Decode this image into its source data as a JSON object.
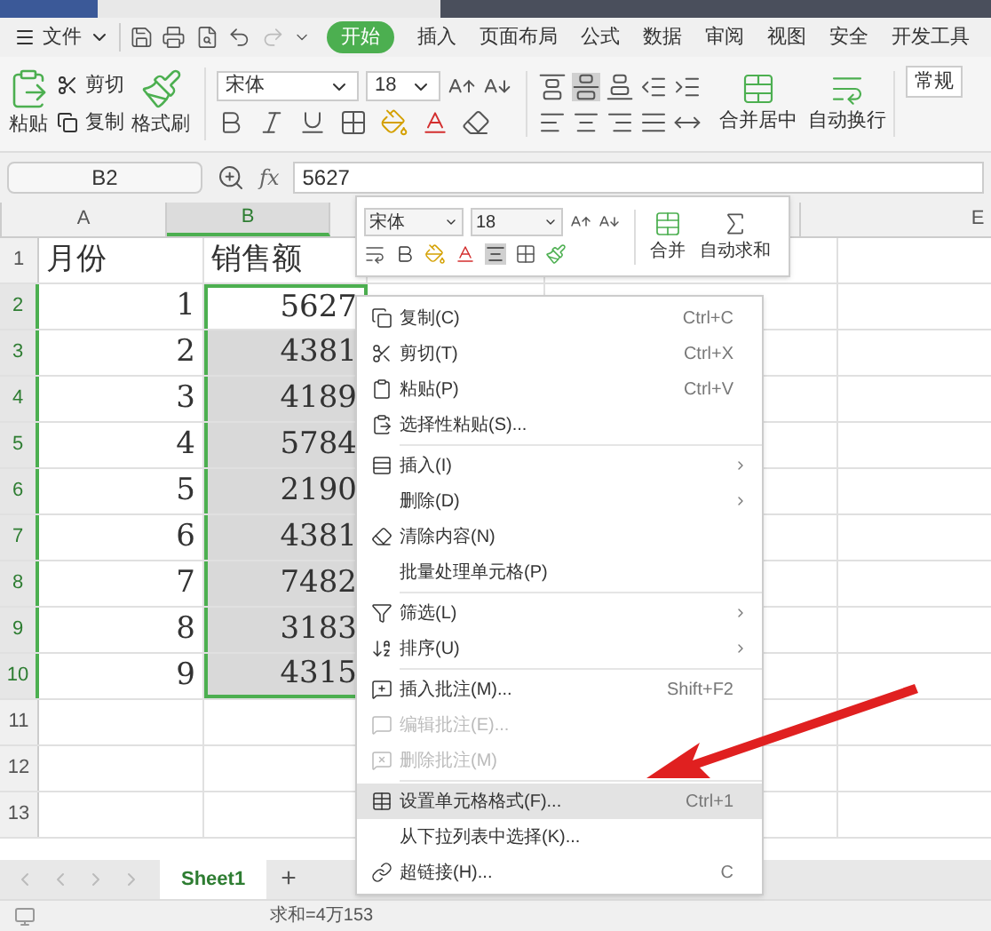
{
  "menu_bar": {
    "file": "文件",
    "tabs": [
      {
        "label": "开始",
        "selected": true
      },
      {
        "label": "插入",
        "selected": false
      },
      {
        "label": "页面布局",
        "selected": false
      },
      {
        "label": "公式",
        "selected": false
      },
      {
        "label": "数据",
        "selected": false
      },
      {
        "label": "审阅",
        "selected": false
      },
      {
        "label": "视图",
        "selected": false
      },
      {
        "label": "安全",
        "selected": false
      },
      {
        "label": "开发工具",
        "selected": false
      }
    ]
  },
  "ribbon": {
    "paste": "粘贴",
    "cut": "剪切",
    "copy": "复制",
    "format_painter": "格式刷",
    "font": "宋体",
    "size": "18",
    "merge": "合并居中",
    "wrap": "自动换行",
    "number_format": "常规"
  },
  "formula_bar": {
    "cell": "B2",
    "fx": "fx",
    "value": "5627"
  },
  "columns": [
    {
      "label": "A",
      "selected": false
    },
    {
      "label": "B",
      "selected": true
    },
    {
      "label": "E",
      "selected": false
    }
  ],
  "rows": [
    {
      "number": "1",
      "selected": false,
      "cells": [
        {
          "text": "月份"
        },
        {
          "text": "销售额",
          "selected": false
        }
      ]
    },
    {
      "number": "2",
      "selected": true,
      "cells": [
        {
          "text": "1"
        },
        {
          "text": "5627",
          "selected": true,
          "active": true
        }
      ]
    },
    {
      "number": "3",
      "selected": true,
      "cells": [
        {
          "text": "2"
        },
        {
          "text": "4381",
          "selected": true,
          "active": false
        }
      ]
    },
    {
      "number": "4",
      "selected": true,
      "cells": [
        {
          "text": "3"
        },
        {
          "text": "4189",
          "selected": true,
          "active": false
        }
      ]
    },
    {
      "number": "5",
      "selected": true,
      "cells": [
        {
          "text": "4"
        },
        {
          "text": "5784",
          "selected": true,
          "active": false
        }
      ]
    },
    {
      "number": "6",
      "selected": true,
      "cells": [
        {
          "text": "5"
        },
        {
          "text": "2190",
          "selected": true,
          "active": false
        }
      ]
    },
    {
      "number": "7",
      "selected": true,
      "cells": [
        {
          "text": "6"
        },
        {
          "text": "4381",
          "selected": true,
          "active": false
        }
      ]
    },
    {
      "number": "8",
      "selected": true,
      "cells": [
        {
          "text": "7"
        },
        {
          "text": "7482",
          "selected": true,
          "active": false
        }
      ]
    },
    {
      "number": "9",
      "selected": true,
      "cells": [
        {
          "text": "8"
        },
        {
          "text": "3183",
          "selected": true,
          "active": false
        }
      ]
    },
    {
      "number": "10",
      "selected": true,
      "cells": [
        {
          "text": "9"
        },
        {
          "text": "4315",
          "selected": true,
          "active": false
        }
      ]
    },
    {
      "number": "11",
      "selected": false
    },
    {
      "number": "12",
      "selected": false
    },
    {
      "number": "13",
      "selected": false
    }
  ],
  "mini_toolbar": {
    "font": "宋体",
    "size": "18",
    "merge": "合并",
    "autosum": "自动求和"
  },
  "context_menu": [
    {
      "kind": "item",
      "label": "复制(C)",
      "shortcut": "Ctrl+C",
      "disabled": false,
      "submenu": false,
      "selected": false
    },
    {
      "kind": "item",
      "label": "剪切(T)",
      "shortcut": "Ctrl+X",
      "disabled": false,
      "submenu": false,
      "selected": false
    },
    {
      "kind": "item",
      "label": "粘贴(P)",
      "shortcut": "Ctrl+V",
      "disabled": false,
      "submenu": false,
      "selected": false
    },
    {
      "kind": "item",
      "label": "选择性粘贴(S)...",
      "disabled": false,
      "submenu": false,
      "selected": false
    },
    {
      "kind": "separator"
    },
    {
      "kind": "item",
      "label": "插入(I)",
      "disabled": false,
      "submenu": true,
      "selected": false
    },
    {
      "kind": "item",
      "label": "删除(D)",
      "disabled": false,
      "submenu": true,
      "selected": false
    },
    {
      "kind": "item",
      "label": "清除内容(N)",
      "disabled": false,
      "submenu": false,
      "selected": false
    },
    {
      "kind": "item",
      "label": "批量处理单元格(P)",
      "disabled": false,
      "submenu": false,
      "selected": false
    },
    {
      "kind": "separator"
    },
    {
      "kind": "item",
      "label": "筛选(L)",
      "disabled": false,
      "submenu": true,
      "selected": false
    },
    {
      "kind": "item",
      "label": "排序(U)",
      "disabled": false,
      "submenu": true,
      "selected": false
    },
    {
      "kind": "separator"
    },
    {
      "kind": "item",
      "label": "插入批注(M)...",
      "shortcut": "Shift+F2",
      "disabled": false,
      "submenu": false,
      "selected": false
    },
    {
      "kind": "item",
      "label": "编辑批注(E)...",
      "disabled": true,
      "submenu": false,
      "selected": false
    },
    {
      "kind": "item",
      "label": "删除批注(M)",
      "disabled": true,
      "submenu": false,
      "selected": false
    },
    {
      "kind": "separator"
    },
    {
      "kind": "item",
      "label": "设置单元格格式(F)...",
      "shortcut": "Ctrl+1",
      "disabled": false,
      "submenu": false,
      "selected": true
    },
    {
      "kind": "item",
      "label": "从下拉列表中选择(K)...",
      "disabled": false,
      "submenu": false,
      "selected": false
    },
    {
      "kind": "item",
      "label": "超链接(H)...",
      "shortcut": "C",
      "disabled": false,
      "submenu": false,
      "selected": false
    }
  ],
  "sheet_tabs": [
    {
      "label": "Sheet1",
      "selected": true
    }
  ],
  "add_sheet": "+",
  "status_bar": {
    "sum": "求和=4万153"
  }
}
